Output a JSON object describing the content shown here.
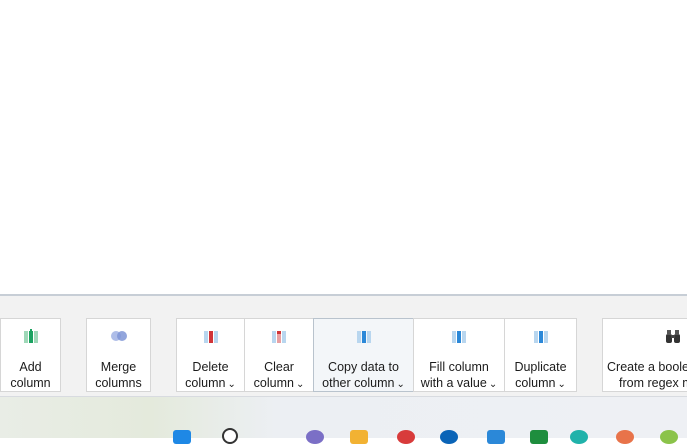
{
  "ribbon": {
    "buttons": [
      {
        "line1": "Add",
        "line2": "column",
        "dropdown": false,
        "icon": "add-column-icon"
      },
      {
        "line1": "Merge",
        "line2": "columns",
        "dropdown": false,
        "icon": "merge-columns-icon"
      },
      {
        "line1": "Delete",
        "line2": "column",
        "dropdown": true,
        "icon": "delete-column-icon"
      },
      {
        "line1": "Clear",
        "line2": "column",
        "dropdown": true,
        "icon": "clear-column-icon"
      },
      {
        "line1": "Copy data to",
        "line2": "other column",
        "dropdown": true,
        "icon": "copy-column-icon"
      },
      {
        "line1": "Fill column",
        "line2": "with a value",
        "dropdown": true,
        "icon": "fill-column-icon"
      },
      {
        "line1": "Duplicate",
        "line2": "column",
        "dropdown": true,
        "icon": "duplicate-column-icon"
      },
      {
        "line1": "Create a boolea",
        "line2": "from regex m",
        "dropdown": false,
        "icon": "binoculars-icon"
      }
    ],
    "chevron": "⌄"
  },
  "colors": {
    "accent_green": "#1aa260",
    "accent_red": "#d13438",
    "accent_blue": "#2b88d8"
  }
}
